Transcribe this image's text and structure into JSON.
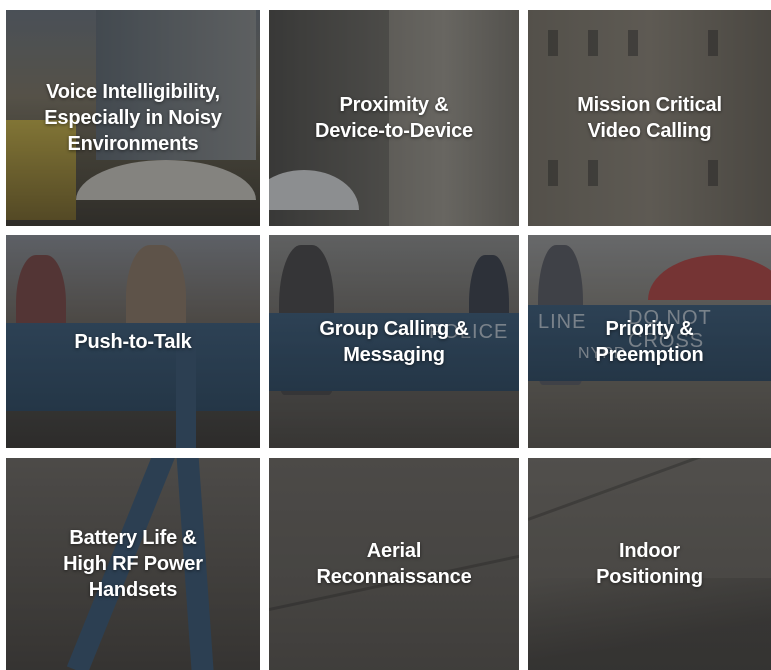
{
  "tiles": [
    {
      "label": "Voice Intelligibility,\nEspecially in Noisy\nEnvironments"
    },
    {
      "label": "Proximity &\nDevice-to-Device"
    },
    {
      "label": "Mission Critical\nVideo Calling"
    },
    {
      "label": "Push-to-Talk"
    },
    {
      "label": "Group Calling &\nMessaging"
    },
    {
      "label": "Priority &\nPreemption"
    },
    {
      "label": "Battery Life &\nHigh RF Power\nHandsets"
    },
    {
      "label": "Aerial\nReconnaissance"
    },
    {
      "label": "Indoor\nPositioning"
    }
  ],
  "barrier_text": {
    "police": "POLICE",
    "line": "LINE",
    "do_not_cross": "DO NOT CROSS",
    "nypd": "NYPD"
  },
  "colors": {
    "label_text": "#ffffff",
    "barrier_blue": "#3c5d7c",
    "overlay": "#141414"
  }
}
